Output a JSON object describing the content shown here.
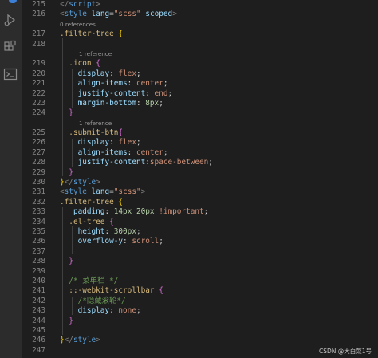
{
  "colors": {
    "background": "#1e1e1e",
    "activity_bar": "#2c2c2c",
    "line_number": "#858585",
    "tag": "#569cd6",
    "attribute": "#9cdcfe",
    "string": "#ce9178",
    "selector": "#d7ba7d",
    "number": "#b5cea8",
    "comment": "#6a9955"
  },
  "activity_bar": {
    "icons": [
      "run-debug-icon",
      "extensions-icon",
      "terminal-icon"
    ]
  },
  "editor": {
    "lines": [
      {
        "kind": "code",
        "num": "215",
        "tokens": [
          [
            "t-punct",
            "</"
          ],
          [
            "t-tag",
            "script"
          ],
          [
            "t-punct",
            ">"
          ]
        ]
      },
      {
        "kind": "code",
        "num": "216",
        "tokens": [
          [
            "t-punct",
            "<"
          ],
          [
            "t-tag",
            "style"
          ],
          [
            "t-plain",
            " "
          ],
          [
            "t-attr",
            "lang"
          ],
          [
            "t-plain",
            "="
          ],
          [
            "t-str",
            "\"scss\""
          ],
          [
            "t-plain",
            " "
          ],
          [
            "t-attr",
            "scoped"
          ],
          [
            "t-punct",
            ">"
          ]
        ]
      },
      {
        "kind": "lens",
        "text": "0 references",
        "indent": 0
      },
      {
        "kind": "code",
        "num": "217",
        "tokens": [
          [
            "t-sel",
            ".filter-tree"
          ],
          [
            "t-plain",
            " "
          ],
          [
            "t-brace1",
            "{"
          ]
        ]
      },
      {
        "kind": "code",
        "num": "218",
        "tokens": []
      },
      {
        "kind": "lens",
        "text": "1 reference",
        "indent": 1
      },
      {
        "kind": "code",
        "num": "219",
        "tokens": [
          [
            "t-plain",
            "  "
          ],
          [
            "t-sel",
            ".icon"
          ],
          [
            "t-plain",
            " "
          ],
          [
            "t-brace2",
            "{"
          ]
        ]
      },
      {
        "kind": "code",
        "num": "220",
        "tokens": [
          [
            "t-plain",
            "    "
          ],
          [
            "t-prop",
            "display"
          ],
          [
            "t-plain",
            ": "
          ],
          [
            "t-val",
            "flex"
          ],
          [
            "t-plain",
            ";"
          ]
        ]
      },
      {
        "kind": "code",
        "num": "221",
        "tokens": [
          [
            "t-plain",
            "    "
          ],
          [
            "t-prop",
            "align-items"
          ],
          [
            "t-plain",
            ": "
          ],
          [
            "t-val",
            "center"
          ],
          [
            "t-plain",
            ";"
          ]
        ]
      },
      {
        "kind": "code",
        "num": "222",
        "tokens": [
          [
            "t-plain",
            "    "
          ],
          [
            "t-prop",
            "justify-content"
          ],
          [
            "t-plain",
            ": "
          ],
          [
            "t-val",
            "end"
          ],
          [
            "t-plain",
            ";"
          ]
        ]
      },
      {
        "kind": "code",
        "num": "223",
        "tokens": [
          [
            "t-plain",
            "    "
          ],
          [
            "t-prop",
            "margin-bottom"
          ],
          [
            "t-plain",
            ": "
          ],
          [
            "t-num",
            "8px"
          ],
          [
            "t-plain",
            ";"
          ]
        ]
      },
      {
        "kind": "code",
        "num": "224",
        "tokens": [
          [
            "t-plain",
            "  "
          ],
          [
            "t-brace2",
            "}"
          ]
        ]
      },
      {
        "kind": "lens",
        "text": "1 reference",
        "indent": 1
      },
      {
        "kind": "code",
        "num": "225",
        "tokens": [
          [
            "t-plain",
            "  "
          ],
          [
            "t-sel",
            ".submit-btn"
          ],
          [
            "t-brace2",
            "{"
          ]
        ]
      },
      {
        "kind": "code",
        "num": "226",
        "tokens": [
          [
            "t-plain",
            "    "
          ],
          [
            "t-prop",
            "display"
          ],
          [
            "t-plain",
            ": "
          ],
          [
            "t-val",
            "flex"
          ],
          [
            "t-plain",
            ";"
          ]
        ]
      },
      {
        "kind": "code",
        "num": "227",
        "tokens": [
          [
            "t-plain",
            "    "
          ],
          [
            "t-prop",
            "align-items"
          ],
          [
            "t-plain",
            ": "
          ],
          [
            "t-val",
            "center"
          ],
          [
            "t-plain",
            ";"
          ]
        ]
      },
      {
        "kind": "code",
        "num": "228",
        "tokens": [
          [
            "t-plain",
            "    "
          ],
          [
            "t-prop",
            "justify-content"
          ],
          [
            "t-plain",
            ":"
          ],
          [
            "t-val",
            "space-between"
          ],
          [
            "t-plain",
            ";"
          ]
        ]
      },
      {
        "kind": "code",
        "num": "229",
        "tokens": [
          [
            "t-plain",
            "  "
          ],
          [
            "t-brace2",
            "}"
          ]
        ]
      },
      {
        "kind": "code",
        "num": "230",
        "tokens": [
          [
            "t-brace1",
            "}"
          ],
          [
            "t-punct",
            "</"
          ],
          [
            "t-tag",
            "style"
          ],
          [
            "t-punct",
            ">"
          ]
        ]
      },
      {
        "kind": "code",
        "num": "231",
        "tokens": [
          [
            "t-punct",
            "<"
          ],
          [
            "t-tag",
            "style"
          ],
          [
            "t-plain",
            " "
          ],
          [
            "t-attr",
            "lang"
          ],
          [
            "t-plain",
            "="
          ],
          [
            "t-str",
            "\"scss\""
          ],
          [
            "t-punct",
            ">"
          ]
        ]
      },
      {
        "kind": "code",
        "num": "232",
        "tokens": [
          [
            "t-sel",
            ".filter-tree"
          ],
          [
            "t-plain",
            " "
          ],
          [
            "t-brace1",
            "{"
          ]
        ]
      },
      {
        "kind": "code",
        "num": "233",
        "tokens": [
          [
            "t-plain",
            "   "
          ],
          [
            "t-prop",
            "padding"
          ],
          [
            "t-plain",
            ": "
          ],
          [
            "t-num",
            "14px 20px"
          ],
          [
            "t-plain",
            " "
          ],
          [
            "t-val",
            "!important"
          ],
          [
            "t-plain",
            ";"
          ]
        ]
      },
      {
        "kind": "code",
        "num": "234",
        "tokens": [
          [
            "t-plain",
            "  "
          ],
          [
            "t-sel",
            ".el-tree"
          ],
          [
            "t-plain",
            " "
          ],
          [
            "t-brace2",
            "{"
          ]
        ]
      },
      {
        "kind": "code",
        "num": "235",
        "tokens": [
          [
            "t-plain",
            "    "
          ],
          [
            "t-prop",
            "height"
          ],
          [
            "t-plain",
            ": "
          ],
          [
            "t-num",
            "300px"
          ],
          [
            "t-plain",
            ";"
          ]
        ]
      },
      {
        "kind": "code",
        "num": "236",
        "tokens": [
          [
            "t-plain",
            "    "
          ],
          [
            "t-prop",
            "overflow-y"
          ],
          [
            "t-plain",
            ": "
          ],
          [
            "t-val",
            "scroll"
          ],
          [
            "t-plain",
            ";"
          ]
        ]
      },
      {
        "kind": "code",
        "num": "237",
        "tokens": []
      },
      {
        "kind": "code",
        "num": "238",
        "tokens": [
          [
            "t-plain",
            "  "
          ],
          [
            "t-brace2",
            "}"
          ]
        ]
      },
      {
        "kind": "code",
        "num": "239",
        "tokens": []
      },
      {
        "kind": "code",
        "num": "240",
        "tokens": [
          [
            "t-plain",
            "  "
          ],
          [
            "t-com",
            "/* 菜单栏 */"
          ]
        ]
      },
      {
        "kind": "code",
        "num": "241",
        "tokens": [
          [
            "t-plain",
            "  "
          ],
          [
            "t-sel",
            "::-webkit-scrollbar"
          ],
          [
            "t-plain",
            " "
          ],
          [
            "t-brace2",
            "{"
          ]
        ]
      },
      {
        "kind": "code",
        "num": "242",
        "tokens": [
          [
            "t-plain",
            "    "
          ],
          [
            "t-com",
            "/*隐藏滚轮*/"
          ]
        ]
      },
      {
        "kind": "code",
        "num": "243",
        "tokens": [
          [
            "t-plain",
            "    "
          ],
          [
            "t-prop",
            "display"
          ],
          [
            "t-plain",
            ": "
          ],
          [
            "t-val",
            "none"
          ],
          [
            "t-plain",
            ";"
          ]
        ]
      },
      {
        "kind": "code",
        "num": "244",
        "tokens": [
          [
            "t-plain",
            "  "
          ],
          [
            "t-brace2",
            "}"
          ]
        ]
      },
      {
        "kind": "code",
        "num": "245",
        "tokens": []
      },
      {
        "kind": "code",
        "num": "246",
        "tokens": [
          [
            "t-brace1",
            "}"
          ],
          [
            "t-punct",
            "</"
          ],
          [
            "t-tag",
            "style"
          ],
          [
            "t-punct",
            ">"
          ]
        ]
      },
      {
        "kind": "code",
        "num": "247",
        "tokens": []
      }
    ]
  },
  "watermark": "CSDN @大白菜1号"
}
